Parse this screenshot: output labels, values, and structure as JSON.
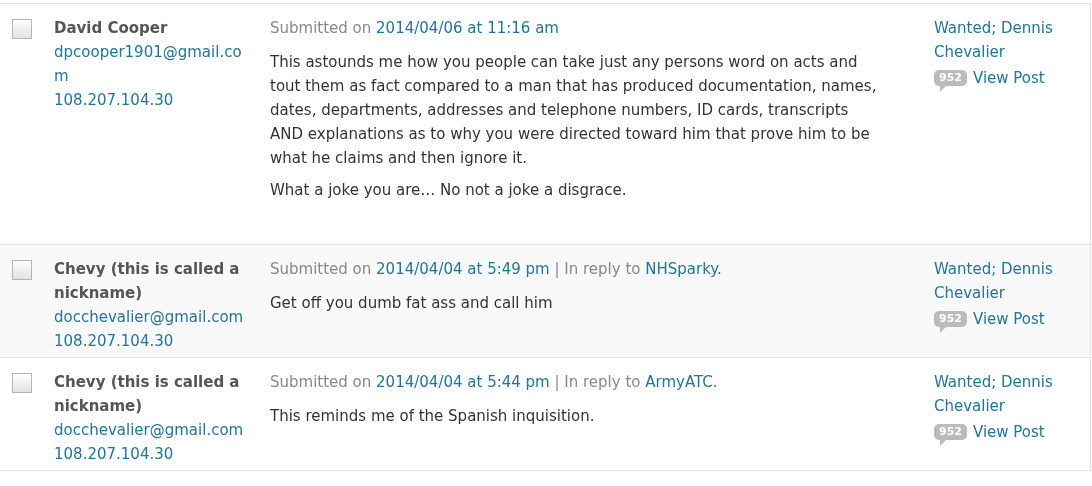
{
  "comments": [
    {
      "checked": false,
      "author": "David Cooper",
      "email": "dpcooper1901@gmail.com",
      "ip": "108.207.104.30",
      "submitted_label": "Submitted on",
      "date": "2014/04/06 at 11:16 am",
      "paragraphs": [
        "This astounds me how you people can take just any persons word on acts and tout them as fact compared to a man that has produced documentation, names, dates, departments, addresses and telephone numbers, ID cards, transcripts AND explanations as to why you were directed toward him that prove him to be what he claims and then ignore it.",
        "What a joke you are… No not a joke a disgrace."
      ],
      "post_title": "Wanted; Dennis Chevalier",
      "comment_count": "952",
      "view_post": "View Post"
    },
    {
      "checked": false,
      "author": "Chevy (this is called a nickname)",
      "email": "docchevalier@gmail.com",
      "ip": "108.207.104.30",
      "submitted_label": "Submitted on",
      "date": "2014/04/04 at 5:49 pm",
      "reply_label": "| In reply to",
      "reply_to": "NHSparky.",
      "paragraphs": [
        "Get off you dumb fat ass and call him"
      ],
      "post_title": "Wanted; Dennis Chevalier",
      "comment_count": "952",
      "view_post": "View Post"
    },
    {
      "checked": false,
      "author": "Chevy (this is called a nickname)",
      "email": "docchevalier@gmail.com",
      "ip": "108.207.104.30",
      "submitted_label": "Submitted on",
      "date": "2014/04/04 at 5:44 pm",
      "reply_label": "| In reply to",
      "reply_to": "ArmyATC.",
      "paragraphs": [
        "This reminds me of the Spanish inquisition."
      ],
      "post_title": "Wanted; Dennis Chevalier",
      "comment_count": "952",
      "view_post": "View Post"
    }
  ]
}
